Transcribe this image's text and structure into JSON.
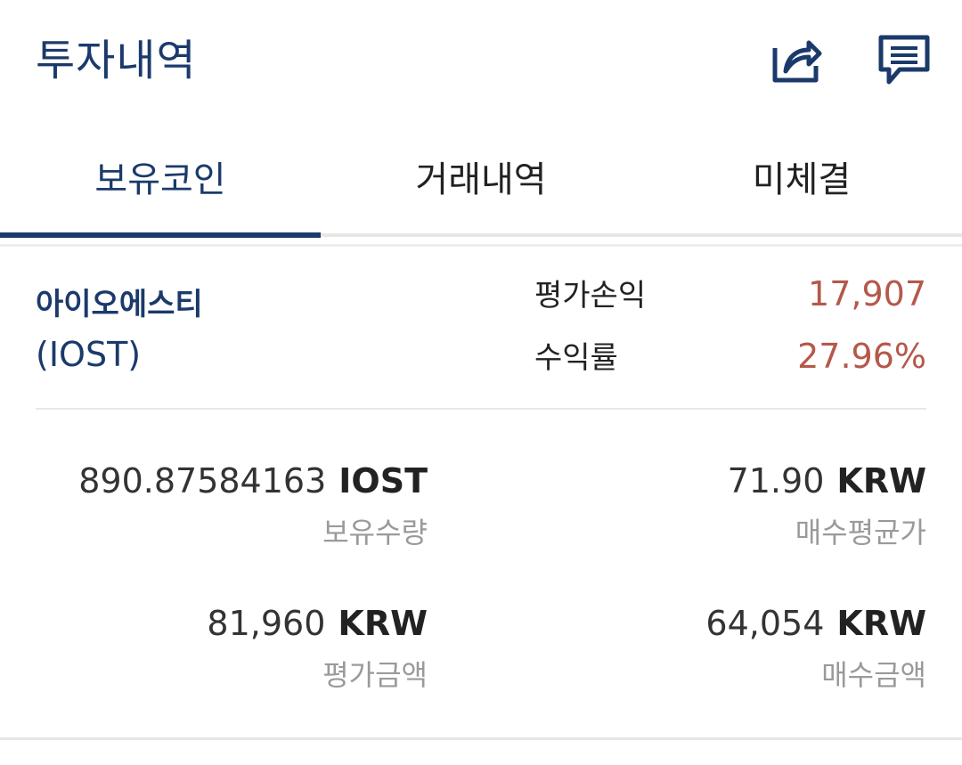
{
  "header": {
    "title": "투자내역",
    "icons": {
      "share": "share-icon",
      "chat": "chat-icon"
    },
    "accent_color": "#1b3a6b"
  },
  "tabs": [
    {
      "label": "보유코인",
      "active": true
    },
    {
      "label": "거래내역",
      "active": false
    },
    {
      "label": "미체결",
      "active": false
    }
  ],
  "holding": {
    "coin_name": "아이오에스티",
    "coin_symbol": "(IOST)",
    "profit_loss_label": "평가손익",
    "profit_loss_value": "17,907",
    "return_rate_label": "수익률",
    "return_rate_value": "27.96%",
    "profit_color": "#b5584a",
    "quantity": {
      "value": "890.87584163",
      "unit": "IOST",
      "label": "보유수량"
    },
    "avg_buy_price": {
      "value": "71.90",
      "unit": "KRW",
      "label": "매수평균가"
    },
    "valuation": {
      "value": "81,960",
      "unit": "KRW",
      "label": "평가금액"
    },
    "buy_amount": {
      "value": "64,054",
      "unit": "KRW",
      "label": "매수금액"
    }
  }
}
